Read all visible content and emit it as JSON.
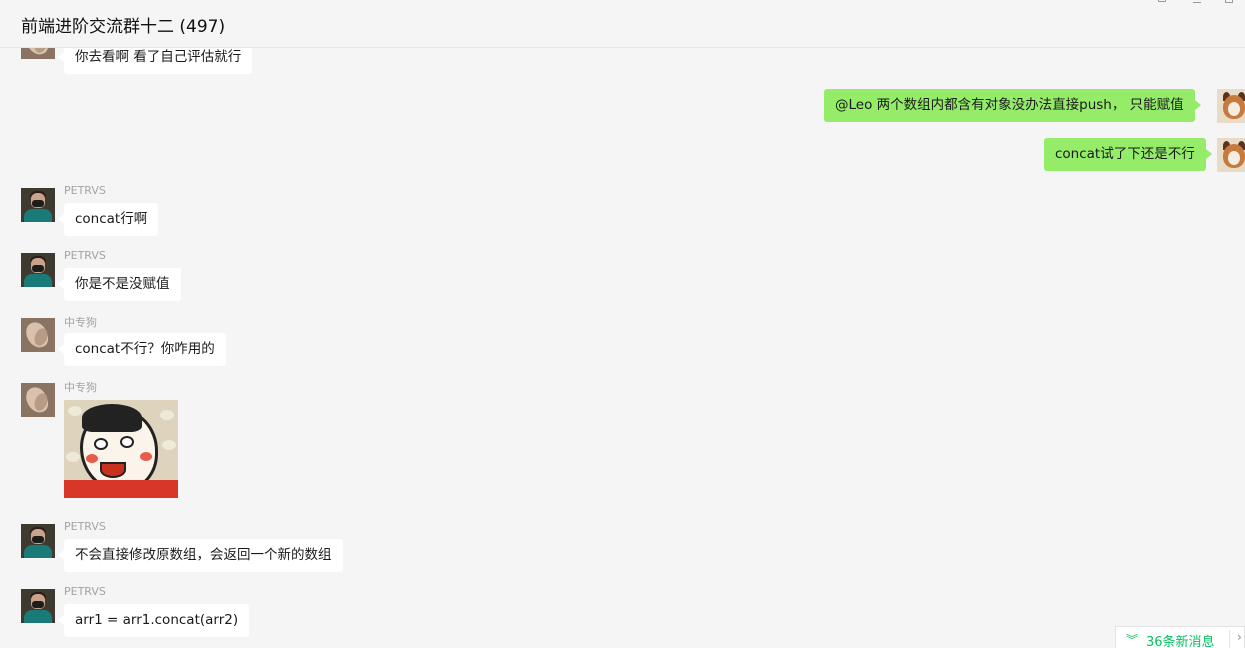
{
  "header": {
    "title": "前端进阶交流群十二 (497)",
    "icons": [
      "pin-icon",
      "minimize-icon",
      "maximize-icon"
    ]
  },
  "messages": [
    {
      "sender": "",
      "direction": "in",
      "avatar": "zhong-avatar",
      "text": "你去看啊 看了自己评估就行"
    },
    {
      "sender": "",
      "direction": "out",
      "avatar": "self-avatar",
      "text": "@Leo  两个数组内都含有对象没办法直接push， 只能赋值"
    },
    {
      "sender": "",
      "direction": "out",
      "avatar": "self-avatar",
      "text": "concat试了下还是不行"
    },
    {
      "sender": "PETRVS",
      "direction": "in",
      "avatar": "petrvs-avatar",
      "text": "concat行啊"
    },
    {
      "sender": "PETRVS",
      "direction": "in",
      "avatar": "petrvs-avatar",
      "text": "你是不是没赋值"
    },
    {
      "sender": "中专狗",
      "direction": "in",
      "avatar": "zhong-avatar",
      "text": "concat不行？你咋用的"
    },
    {
      "sender": "中专狗",
      "direction": "in",
      "avatar": "zhong-avatar",
      "type": "sticker",
      "sticker": "cartoon-face-sticker"
    },
    {
      "sender": "PETRVS",
      "direction": "in",
      "avatar": "petrvs-avatar",
      "text": "不会直接修改原数组，会返回一个新的数组"
    },
    {
      "sender": "PETRVS",
      "direction": "in",
      "avatar": "petrvs-avatar",
      "text": "arr1 = arr1.concat(arr2)"
    }
  ],
  "new_messages": {
    "label": "36条新消息",
    "icon": "double-chevron-down-icon"
  },
  "colors": {
    "background": "#f5f5f5",
    "incoming_bubble": "#ffffff",
    "outgoing_bubble": "#95ec69",
    "accent": "#07c160",
    "sender_name": "#a3a3a3"
  }
}
